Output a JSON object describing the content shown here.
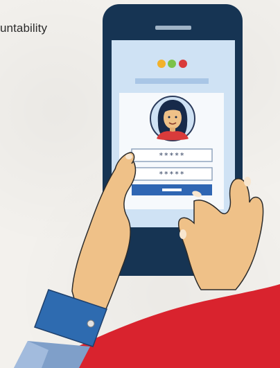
{
  "caption": "untability",
  "login": {
    "username_mask": "*****",
    "password_mask": "*****"
  },
  "colors": {
    "phone_body": "#163453",
    "screen": "#cfe2f4",
    "card": "#f6f9fc",
    "button": "#2f66b3",
    "dot_yellow": "#f2b12b",
    "dot_green": "#7cc24a",
    "dot_red": "#d93b3b",
    "skin": "#efc188",
    "sleeve": "#2e6bb0",
    "shirt_cuff": "#7f9fc9",
    "red_shape": "#d9232e"
  },
  "icons": {
    "user_avatar": "woman-avatar-icon",
    "traffic_dots": "window-dots-icon"
  }
}
